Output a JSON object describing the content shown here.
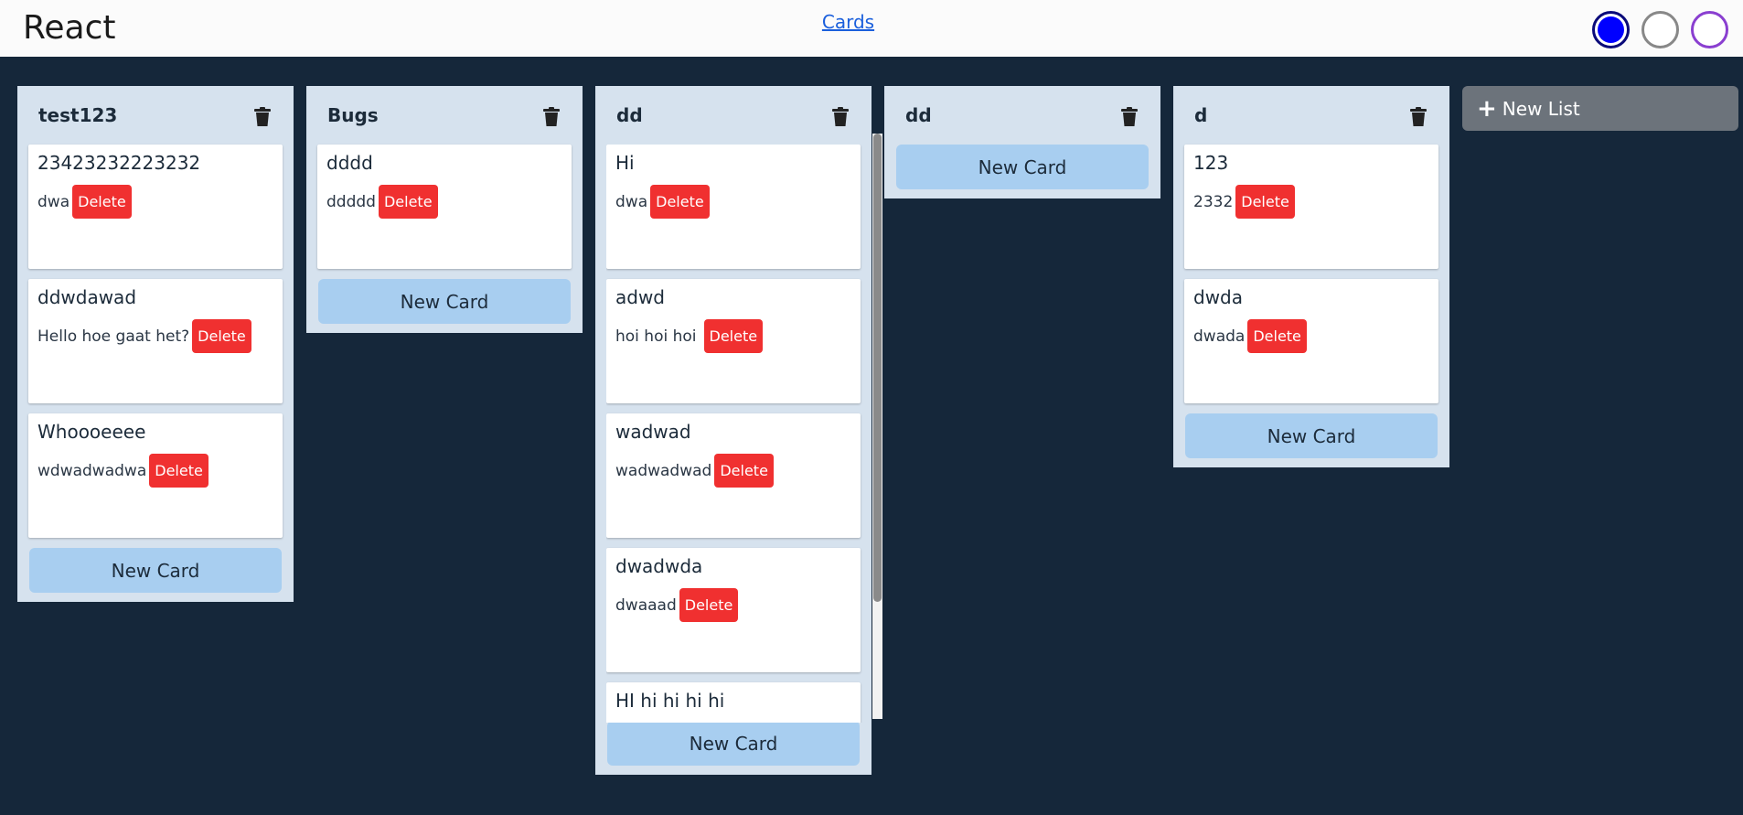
{
  "header": {
    "app_title": "React",
    "nav_link": "Cards",
    "themes": [
      "blue",
      "gray",
      "purple"
    ]
  },
  "lists": [
    {
      "title": "test123",
      "cards": [
        {
          "title": "23423232223232",
          "desc": "dwa"
        },
        {
          "title": "ddwdawad",
          "desc": "Hello hoe gaat het?"
        },
        {
          "title": "Whoooeeee",
          "desc": "wdwadwadwa"
        }
      ]
    },
    {
      "title": "Bugs",
      "cards": [
        {
          "title": "dddd",
          "desc": "ddddd"
        }
      ]
    },
    {
      "title": "dd",
      "cards": [
        {
          "title": "Hi",
          "desc": "dwa"
        },
        {
          "title": "adwd",
          "desc": "hoi hoi hoi"
        },
        {
          "title": "wadwad",
          "desc": "wadwadwad"
        },
        {
          "title": "dwadwda",
          "desc": "dwaaad"
        },
        {
          "title": "HI hi hi hi hi",
          "desc": ""
        }
      ]
    },
    {
      "title": "dd",
      "cards": []
    },
    {
      "title": "d",
      "cards": [
        {
          "title": "123",
          "desc": "2332"
        },
        {
          "title": "dwda",
          "desc": "dwada"
        }
      ]
    }
  ],
  "labels": {
    "delete": "Delete",
    "new_card": "New Card",
    "new_list": "New List"
  },
  "colors": {
    "background": "#15273a",
    "list_bg": "#d6e2ee",
    "delete": "#f03030",
    "new_card": "#a8cef0",
    "new_list": "#6c737b",
    "link": "#1a5fdc"
  }
}
